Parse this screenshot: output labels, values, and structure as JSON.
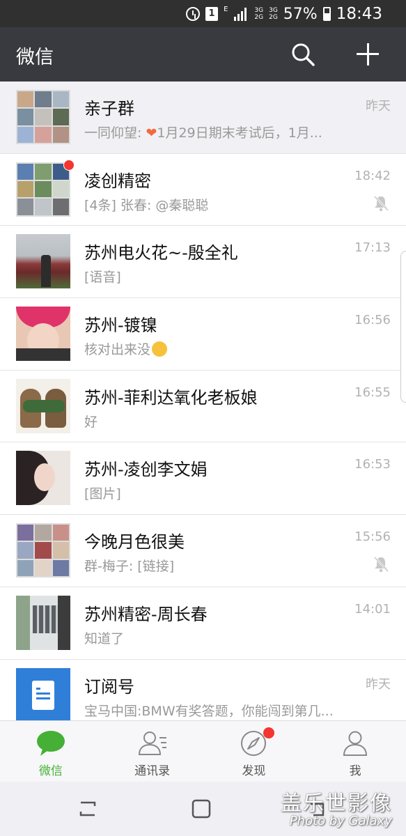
{
  "status_bar": {
    "sim_label": "1",
    "network_e": "E",
    "net_top": "3G",
    "net_bottom": "2G",
    "net_top2": "3G",
    "battery": "57%",
    "time": "18:43"
  },
  "header": {
    "title": "微信",
    "search_icon": "search-icon",
    "add_icon": "plus-icon"
  },
  "chats": [
    {
      "name": "亲子群",
      "preview_before": "一同仰望: ",
      "preview_after": "1月29日期末考试后，1月...",
      "time": "昨天",
      "pinned": true,
      "muted": false,
      "unread_dot": false
    },
    {
      "name": "凌创精密",
      "preview": "[4条] 张春: @秦聪聪",
      "time": "18:42",
      "muted": true,
      "unread_dot": true
    },
    {
      "name": "苏州电火花~-殷全礼",
      "preview": "[语音]",
      "time": "17:13",
      "muted": false
    },
    {
      "name": "苏州-镀镍",
      "preview": "核对出来没",
      "time": "16:56",
      "muted": false
    },
    {
      "name": "苏州-菲利达氧化老板娘",
      "preview": "好",
      "time": "16:55",
      "muted": false
    },
    {
      "name": "苏州-凌创李文娟",
      "preview": "[图片]",
      "time": "16:53",
      "muted": false
    },
    {
      "name": "今晚月色很美",
      "preview": "群-梅子: [链接]",
      "time": "15:56",
      "muted": true
    },
    {
      "name": "苏州精密-周长春",
      "preview": "知道了",
      "time": "14:01",
      "muted": false
    },
    {
      "name": "订阅号",
      "preview": "宝马中国:BMW有奖答题，你能闯到第几...",
      "time": "昨天",
      "muted": false
    }
  ],
  "tabs": [
    {
      "label": "微信",
      "icon": "chat-bubble-icon",
      "active": true
    },
    {
      "label": "通讯录",
      "icon": "contacts-icon",
      "active": false
    },
    {
      "label": "发现",
      "icon": "compass-icon",
      "active": false,
      "dot": true
    },
    {
      "label": "我",
      "icon": "person-icon",
      "active": false
    }
  ],
  "watermark": {
    "line1": "盖乐世影像",
    "line2": "Photo by Galaxy"
  },
  "colors": {
    "header_bg": "#393a3f",
    "accent_green": "#45b035",
    "badge_red": "#f43530"
  }
}
